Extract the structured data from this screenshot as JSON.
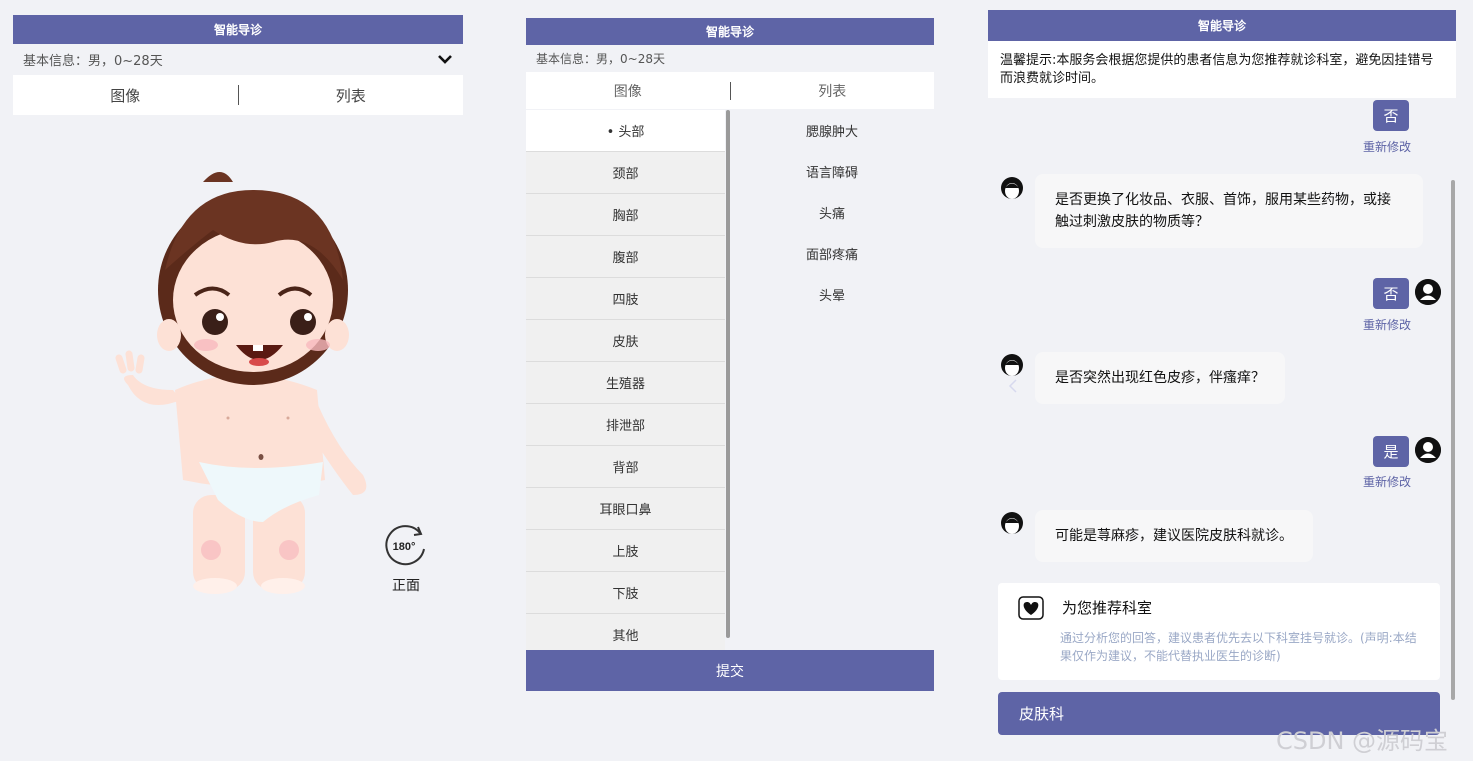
{
  "panel1": {
    "header_title": "智能导诊",
    "basic_info": "基本信息：男，0~28天",
    "tabs": [
      "图像",
      "列表"
    ],
    "rotate_badge": "180°",
    "view_label": "正面"
  },
  "panel2": {
    "header_title": "智能导诊",
    "basic_info": "基本信息：男，0~28天",
    "tabs": [
      "图像",
      "列表"
    ],
    "categories": [
      "• 头部",
      "颈部",
      "胸部",
      "腹部",
      "四肢",
      "皮肤",
      "生殖器",
      "排泄部",
      "背部",
      "耳眼口鼻",
      "上肢",
      "下肢",
      "其他"
    ],
    "symptoms": [
      "腮腺肿大",
      "语言障碍",
      "头痛",
      "面部疼痛",
      "头晕"
    ],
    "submit_label": "提交"
  },
  "panel3": {
    "header_title": "智能导诊",
    "tip": "温馨提示:本服务会根据您提供的患者信息为您推荐就诊科室，避免因挂错号而浪费就诊时间。",
    "answers": [
      "否",
      "否",
      "是"
    ],
    "redo_label": "重新修改",
    "questions": [
      "是否更换了化妆品、衣服、首饰，服用某些药物，或接触过刺激皮肤的物质等？",
      "是否突然出现红色皮疹，伴瘙痒？",
      "可能是荨麻疹，建议医院皮肤科就诊。"
    ],
    "recommend_title": "为您推荐科室",
    "recommend_desc": "通过分析您的回答，建议患者优先去以下科室挂号就诊。(声明:本结果仅作为建议，不能代替执业医生的诊断)",
    "department": "皮肤科"
  },
  "watermark": "CSDN @源码宝",
  "colors": {
    "accent": "#5e64a6",
    "background": "#f1f2f6"
  }
}
